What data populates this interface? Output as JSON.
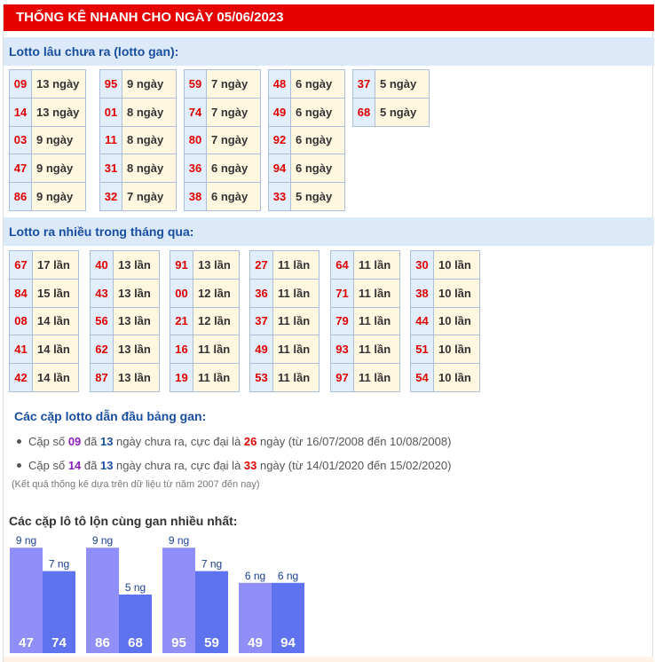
{
  "header": {
    "title": "THỐNG KÊ NHANH CHO NGÀY 05/06/2023"
  },
  "gan_section": {
    "title": "Lotto lâu chưa ra (lotto gan):",
    "groups": [
      [
        [
          "09",
          "13 ngày"
        ],
        [
          "14",
          "13 ngày"
        ],
        [
          "03",
          "9 ngày"
        ],
        [
          "47",
          "9 ngày"
        ],
        [
          "86",
          "9 ngày"
        ]
      ],
      [
        [
          "95",
          "9 ngày"
        ],
        [
          "01",
          "8 ngày"
        ],
        [
          "11",
          "8 ngày"
        ],
        [
          "31",
          "8 ngày"
        ],
        [
          "32",
          "7 ngày"
        ]
      ],
      [
        [
          "59",
          "7 ngày"
        ],
        [
          "74",
          "7 ngày"
        ],
        [
          "80",
          "7 ngày"
        ],
        [
          "36",
          "6 ngày"
        ],
        [
          "38",
          "6 ngày"
        ]
      ],
      [
        [
          "48",
          "6 ngày"
        ],
        [
          "49",
          "6 ngày"
        ],
        [
          "92",
          "6 ngày"
        ],
        [
          "94",
          "6 ngày"
        ],
        [
          "33",
          "5 ngày"
        ]
      ],
      [
        [
          "37",
          "5 ngày"
        ],
        [
          "68",
          "5 ngày"
        ]
      ]
    ]
  },
  "freq_section": {
    "title": "Lotto ra nhiều trong tháng qua:",
    "groups": [
      [
        [
          "67",
          "17 lần"
        ],
        [
          "84",
          "15 lần"
        ],
        [
          "08",
          "14 lần"
        ],
        [
          "41",
          "14 lần"
        ],
        [
          "42",
          "14 lần"
        ]
      ],
      [
        [
          "40",
          "13 lần"
        ],
        [
          "43",
          "13 lần"
        ],
        [
          "56",
          "13 lần"
        ],
        [
          "62",
          "13 lần"
        ],
        [
          "87",
          "13 lần"
        ]
      ],
      [
        [
          "91",
          "13 lần"
        ],
        [
          "00",
          "12 lần"
        ],
        [
          "21",
          "12 lần"
        ],
        [
          "16",
          "11 lần"
        ],
        [
          "19",
          "11 lần"
        ]
      ],
      [
        [
          "27",
          "11 lần"
        ],
        [
          "36",
          "11 lần"
        ],
        [
          "37",
          "11 lần"
        ],
        [
          "49",
          "11 lần"
        ],
        [
          "53",
          "11 lần"
        ]
      ],
      [
        [
          "64",
          "11 lần"
        ],
        [
          "71",
          "11 lần"
        ],
        [
          "79",
          "11 lần"
        ],
        [
          "93",
          "11 lần"
        ],
        [
          "97",
          "11 lần"
        ]
      ],
      [
        [
          "30",
          "10 lần"
        ],
        [
          "38",
          "10 lần"
        ],
        [
          "44",
          "10 lần"
        ],
        [
          "51",
          "10 lần"
        ],
        [
          "54",
          "10 lần"
        ]
      ]
    ]
  },
  "leaders": {
    "title": "Các cặp lotto dẫn đầu bảng gan:",
    "items": [
      {
        "t1": "Cặp số ",
        "num": "09",
        "t2": " đã ",
        "days": "13",
        "t3": " ngày chưa ra, cực đại là ",
        "max": "26",
        "t4": " ngày (từ 16/07/2008 đến 10/08/2008)"
      },
      {
        "t1": "Cặp số ",
        "num": "14",
        "t2": " đã ",
        "days": "13",
        "t3": " ngày chưa ra, cực đại là ",
        "max": "33",
        "t4": " ngày (từ 14/01/2020 đến 15/02/2020)"
      }
    ],
    "note": "(Kết quả thống kê dựa trên dữ liệu từ năm 2007 đến nay)"
  },
  "pairs_title": "Các cặp lô tô lộn cùng gan nhiều nhất:",
  "colors": {
    "header_red": "#e60000",
    "bar_light": "#8f8ff7",
    "bar_dark": "#5f73f0",
    "num_red": "#e00000",
    "section_blue": "#1a4fa0"
  },
  "chart_data": {
    "type": "bar",
    "title": "Các cặp lô tô lộn cùng gan nhiều nhất:",
    "unit_suffix": " ng",
    "pairs": [
      [
        {
          "label": "47",
          "value": 9
        },
        {
          "label": "74",
          "value": 7
        }
      ],
      [
        {
          "label": "86",
          "value": 9
        },
        {
          "label": "68",
          "value": 5
        }
      ],
      [
        {
          "label": "95",
          "value": 9
        },
        {
          "label": "59",
          "value": 7
        }
      ],
      [
        {
          "label": "49",
          "value": 6
        },
        {
          "label": "94",
          "value": 6
        }
      ]
    ]
  }
}
